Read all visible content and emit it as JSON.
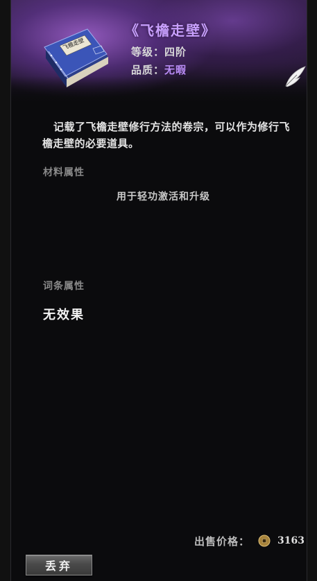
{
  "item": {
    "title": "《飞檐走壁》",
    "grade_label": "等级：",
    "grade_value": "四阶",
    "quality_label": "品质：",
    "quality_value": "无暇",
    "book_cover_text": "飞檐走壁",
    "description": "记载了飞檐走壁修行方法的卷宗，可以作为修行飞檐走壁的必要道具。"
  },
  "sections": {
    "material_label": "材料属性",
    "material_text": "用于轻功激活和升级",
    "affix_label": "词条属性",
    "affix_text": "无效果"
  },
  "footer": {
    "price_label": "出售价格：",
    "price_value": "3163",
    "discard_label": "丢弃"
  },
  "icons": {
    "item": "book-icon",
    "feather": "feather-icon",
    "currency": "coin-icon"
  },
  "colors": {
    "title": "#c9a0ff",
    "quality": "#b98cf5",
    "header_accent": "#7a4aa8"
  }
}
